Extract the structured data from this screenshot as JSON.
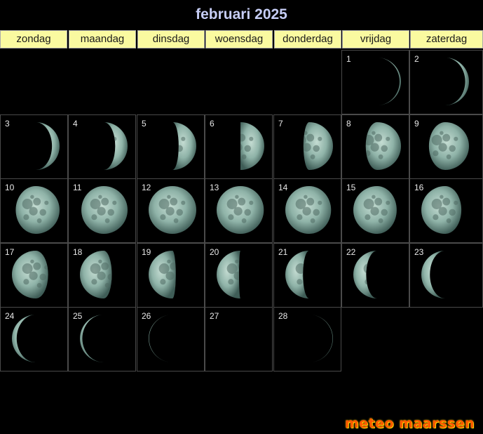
{
  "title": "februari 2025",
  "weekdays": [
    "zondag",
    "maandag",
    "dinsdag",
    "woensdag",
    "donderdag",
    "vrijdag",
    "zaterdag"
  ],
  "days": [
    {
      "day": "1",
      "illumination": 0.03,
      "waxing": true
    },
    {
      "day": "2",
      "illumination": 0.08,
      "waxing": true
    },
    {
      "day": "3",
      "illumination": 0.16,
      "waxing": true
    },
    {
      "day": "4",
      "illumination": 0.26,
      "waxing": true
    },
    {
      "day": "5",
      "illumination": 0.37,
      "waxing": true
    },
    {
      "day": "6",
      "illumination": 0.5,
      "waxing": true
    },
    {
      "day": "7",
      "illumination": 0.62,
      "waxing": true
    },
    {
      "day": "8",
      "illumination": 0.74,
      "waxing": true
    },
    {
      "day": "9",
      "illumination": 0.84,
      "waxing": true
    },
    {
      "day": "10",
      "illumination": 0.92,
      "waxing": true
    },
    {
      "day": "11",
      "illumination": 0.97,
      "waxing": true
    },
    {
      "day": "12",
      "illumination": 1.0,
      "waxing": true
    },
    {
      "day": "13",
      "illumination": 0.99,
      "waxing": false
    },
    {
      "day": "14",
      "illumination": 0.96,
      "waxing": false
    },
    {
      "day": "15",
      "illumination": 0.91,
      "waxing": false
    },
    {
      "day": "16",
      "illumination": 0.84,
      "waxing": false
    },
    {
      "day": "17",
      "illumination": 0.76,
      "waxing": false
    },
    {
      "day": "18",
      "illumination": 0.67,
      "waxing": false
    },
    {
      "day": "19",
      "illumination": 0.57,
      "waxing": false
    },
    {
      "day": "20",
      "illumination": 0.47,
      "waxing": false
    },
    {
      "day": "21",
      "illumination": 0.37,
      "waxing": false
    },
    {
      "day": "22",
      "illumination": 0.27,
      "waxing": false
    },
    {
      "day": "23",
      "illumination": 0.18,
      "waxing": false
    },
    {
      "day": "24",
      "illumination": 0.1,
      "waxing": false
    },
    {
      "day": "25",
      "illumination": 0.05,
      "waxing": false
    },
    {
      "day": "26",
      "illumination": 0.01,
      "waxing": false
    },
    {
      "day": "27",
      "illumination": 0.0,
      "waxing": false
    },
    {
      "day": "28",
      "illumination": 0.01,
      "waxing": true
    }
  ],
  "first_weekday_index": 5,
  "brand": "meteo maarssen",
  "colors": {
    "title": "#c6cdf5",
    "header_bg": "#fafaa0",
    "moon_light": "#8fb3a8",
    "moon_dark": "#000000",
    "brand": "#ff5a00"
  }
}
